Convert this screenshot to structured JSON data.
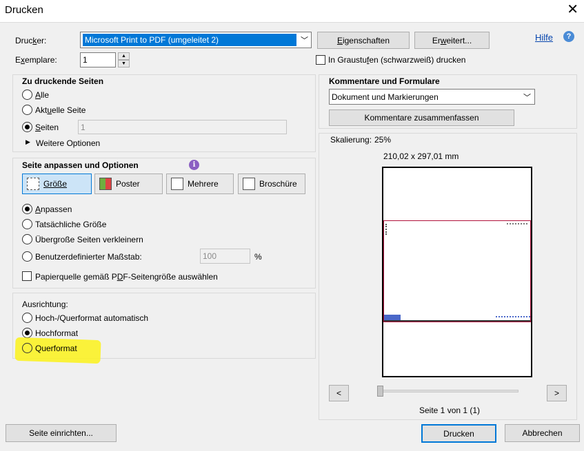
{
  "window": {
    "title": "Drucken",
    "close_glyph": "✕"
  },
  "printer": {
    "label_pre": "Druc",
    "label_ul": "k",
    "label_post": "er:",
    "selected": "Microsoft Print to PDF (umgeleitet 2)",
    "properties_pre": "",
    "properties_ul": "E",
    "properties_post": "igenschaften",
    "advanced_pre": "Er",
    "advanced_ul": "w",
    "advanced_post": "eitert...",
    "help": "Hilfe",
    "copies_pre": "E",
    "copies_ul": "x",
    "copies_post": "emplare:",
    "copies_value": "1",
    "grayscale_pre": "In Graustu",
    "grayscale_ul": "f",
    "grayscale_post": "en (schwarzweiß) drucken",
    "grayscale_checked": false
  },
  "pages": {
    "heading": "Zu druckende Seiten",
    "all_ul": "A",
    "all_post": "lle",
    "current_pre": "Akt",
    "current_ul": "u",
    "current_post": "elle Seite",
    "range_ul": "S",
    "range_post": "eiten",
    "range_value": "1",
    "more_options": "Weitere Optionen",
    "selected": "range"
  },
  "sizing": {
    "heading": "Seite anpassen und Optionen",
    "info_icon": "info-icon",
    "tabs": [
      {
        "label": "Größe",
        "icon": "size-icon",
        "active": true
      },
      {
        "label": "Poster",
        "icon": "poster-icon",
        "active": false
      },
      {
        "label": "Mehrere",
        "icon": "multiple-icon",
        "active": false
      },
      {
        "label": "Broschüre",
        "icon": "booklet-icon",
        "active": false
      }
    ],
    "fit_ul": "A",
    "fit_post": "npassen",
    "actual": "Tatsächliche Größe",
    "shrink": "Übergroße Seiten verkleinern",
    "custom": "Benutzerdefinierter Maßstab:",
    "custom_value": "100",
    "percent": "%",
    "paper_source_pre": "Papierquelle gemäß P",
    "paper_source_ul": "D",
    "paper_source_post": "F-Seitengröße auswählen",
    "selected": "fit"
  },
  "orientation": {
    "heading": "Ausrichtung:",
    "auto": "Hoch-/Querformat automatisch",
    "portrait": "Hochformat",
    "landscape": "Querformat",
    "selected": "portrait"
  },
  "comments": {
    "heading": "Kommentare und Formulare",
    "selected": "Dokument und Markierungen",
    "summarize": "Kommentare zusammenfassen"
  },
  "preview": {
    "scaling_label": "Skalierung:",
    "scaling_value": "25%",
    "dimensions": "210,02 x 297,01 mm",
    "prev": "<",
    "next": ">",
    "page_info": "Seite 1 von 1 (1)"
  },
  "footer": {
    "page_setup": "Seite einrichten...",
    "print": "Drucken",
    "cancel": "Abbrechen"
  },
  "colors": {
    "accent": "#0078d7",
    "selection": "#0078d7",
    "highlight": "#fbf21a",
    "help_link": "#0645ad"
  }
}
